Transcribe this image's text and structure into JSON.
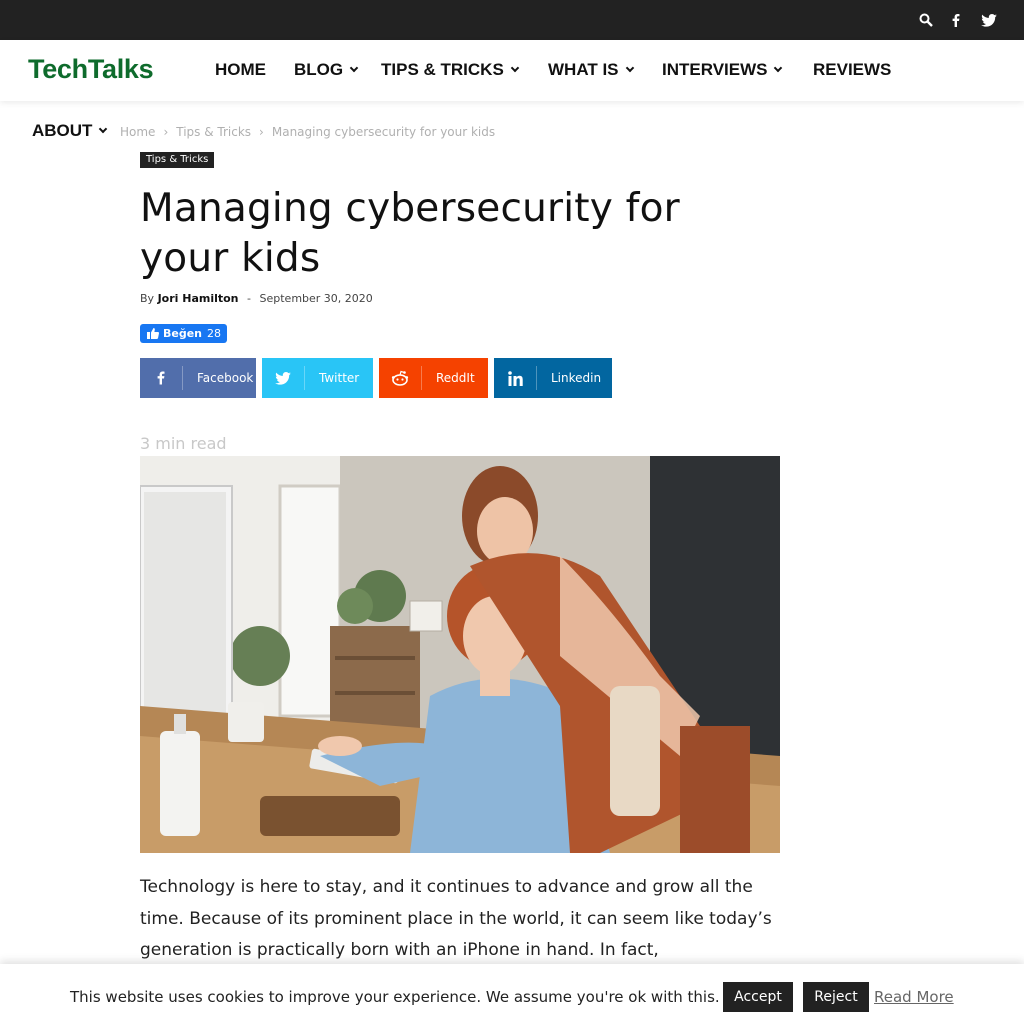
{
  "topbar": {
    "icons": [
      "search-icon",
      "facebook-icon",
      "twitter-icon"
    ],
    "background": "#222222"
  },
  "header": {
    "logo": "TechTalks",
    "logo_color": "#0e6b2c",
    "nav": [
      {
        "label": "HOME",
        "has_dropdown": false
      },
      {
        "label": "BLOG",
        "has_dropdown": true
      },
      {
        "label": "TIPS & TRICKS",
        "has_dropdown": true
      },
      {
        "label": "WHAT IS",
        "has_dropdown": true
      },
      {
        "label": "INTERVIEWS",
        "has_dropdown": true
      },
      {
        "label": "REVIEWS",
        "has_dropdown": false
      }
    ],
    "about": "ABOUT"
  },
  "breadcrumb": {
    "items": [
      "Home",
      "Tips & Tricks",
      "Managing cybersecurity for your kids"
    ],
    "separator": "›"
  },
  "article": {
    "category": "Tips & Tricks",
    "title": "Managing cybersecurity for your kids",
    "by": "By",
    "author": "Jori Hamilton",
    "dash": "-",
    "date": "September 30, 2020",
    "like": {
      "label": "Beğen",
      "count": "28",
      "color": "#1877f2"
    },
    "share": [
      {
        "label": "Facebook",
        "icon": "facebook-icon",
        "color": "#516eab"
      },
      {
        "label": "Twitter",
        "icon": "twitter-icon",
        "color": "#29c5f6"
      },
      {
        "label": "ReddIt",
        "icon": "reddit-icon",
        "color": "#f54200"
      },
      {
        "label": "Linkedin",
        "icon": "linkedin-icon",
        "color": "#0266a0"
      }
    ],
    "read_time": "3 min read",
    "body": "Technology is here to stay, and it continues to advance and grow all the time. Because of its prominent place in the world, it can seem like today’s generation is practically born with an iPhone in hand. In fact,"
  },
  "cookie": {
    "message": "This website uses cookies to improve your experience. We assume you're ok with this.",
    "accept": "Accept",
    "reject": "Reject",
    "read_more": "Read More"
  }
}
